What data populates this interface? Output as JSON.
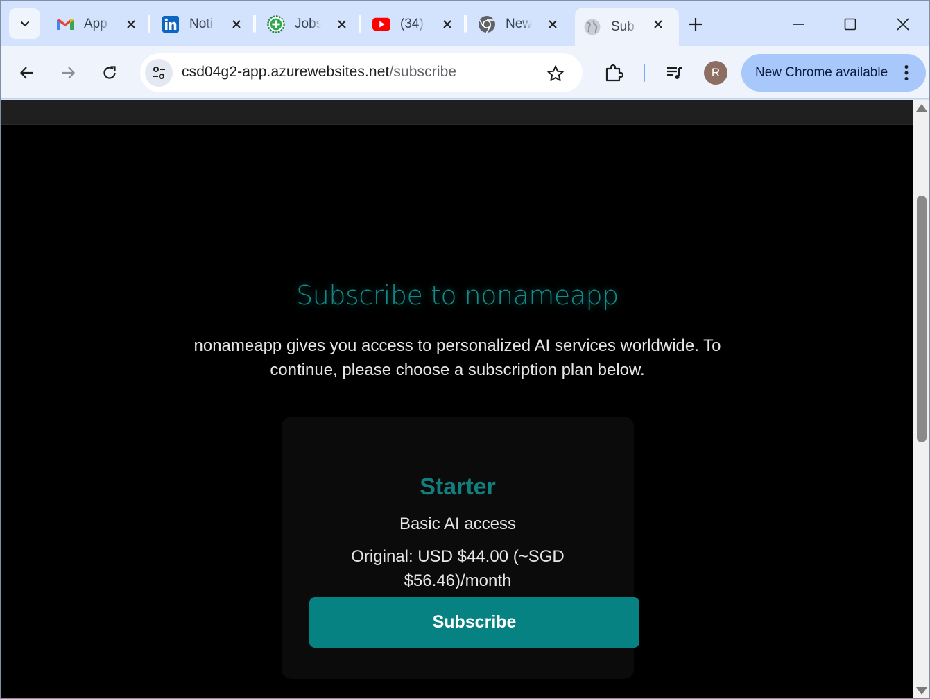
{
  "browser": {
    "tabs": [
      {
        "label": "App",
        "icon": "gmail-icon"
      },
      {
        "label": "Noti",
        "icon": "linkedin-icon"
      },
      {
        "label": "Jobs",
        "icon": "jobs-plus-icon"
      },
      {
        "label": "(34)",
        "icon": "youtube-icon"
      },
      {
        "label": "New",
        "icon": "chrome-icon"
      },
      {
        "label": "Sub",
        "icon": "globe-icon",
        "active": true
      }
    ],
    "url_host": "csd04g2-app.azurewebsites.net",
    "url_path": "/subscribe",
    "avatar_letter": "R",
    "update_label": "New Chrome available"
  },
  "page": {
    "title": "Subscribe to nonameapp",
    "description": "nonameapp gives you access to personalized AI services worldwide. To continue, please choose a subscription plan below.",
    "plan": {
      "name": "Starter",
      "description": "Basic AI access",
      "price": "Original: USD $44.00 (~SGD $56.46)/month",
      "button_label": "Subscribe"
    }
  },
  "colors": {
    "accent_teal": "#068282",
    "page_background": "#000000",
    "card_background": "#0b0b0b"
  }
}
